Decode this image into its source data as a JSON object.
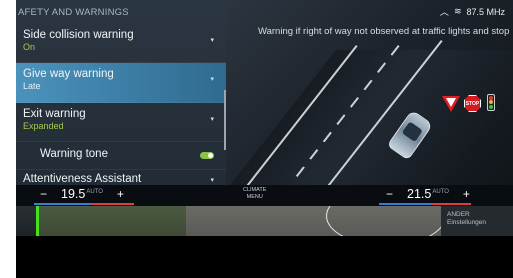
{
  "menu": {
    "header": "AFETY AND WARNINGS",
    "items": [
      {
        "label": "Side collision warning",
        "value": "On"
      },
      {
        "label": "Give way warning",
        "value": "Late",
        "selected": true
      },
      {
        "label": "Exit warning",
        "value": "Expanded"
      }
    ],
    "sub_item": {
      "label": "Warning tone",
      "toggle": "on"
    },
    "last_item": {
      "label": "Attentiveness Assistant"
    }
  },
  "visualization": {
    "message": "Warning if right of way not observed at traffic lights and stop",
    "stop_sign_text": "STOP"
  },
  "status_bar": {
    "radio": "87.5 MHz"
  },
  "climate": {
    "left_temp": "19.5",
    "right_temp": "21.5",
    "auto_label": "AUTO",
    "minus": "−",
    "plus": "+",
    "menu_line1": "CLIMATE",
    "menu_line2": "MENU"
  },
  "camera": {
    "right_text_1": "ANDER",
    "right_text_2": "Einstellungen"
  },
  "colors": {
    "accent_green": "#a3cc4b",
    "selected_blue": "#3f86b2",
    "warning_red": "#e01e24"
  }
}
